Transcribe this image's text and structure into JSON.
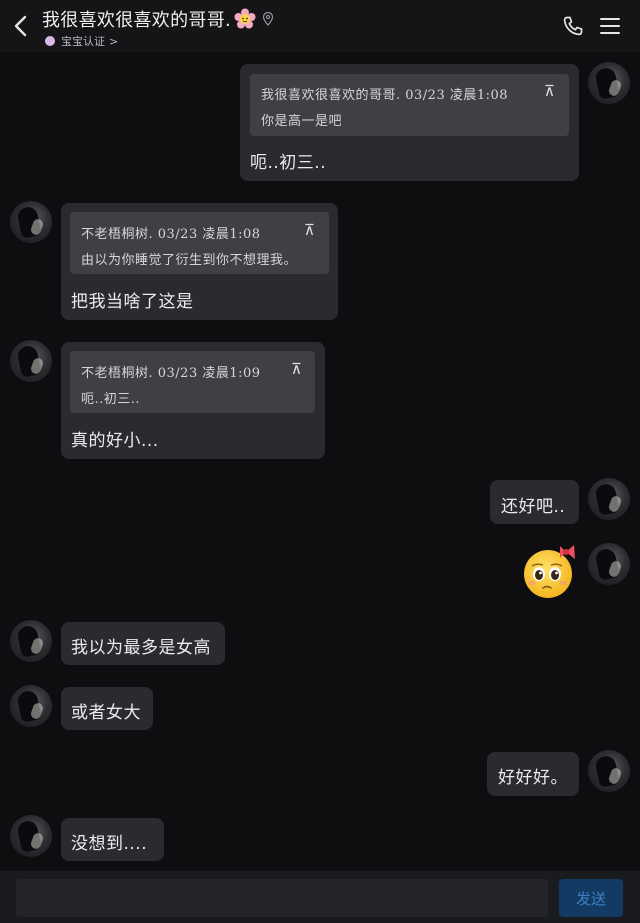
{
  "header": {
    "title": "我很喜欢很喜欢的哥哥.",
    "subtitle": "宝宝认证",
    "subtitle_chevron": ">"
  },
  "icons": {
    "back": "back-arrow-icon",
    "title_emoji": "flower-face-emoji",
    "pin": "location-pin-icon",
    "phone": "phone-icon",
    "menu": "hamburger-menu-icon",
    "sticker": "pleading-face-with-bow-sticker"
  },
  "messages": [
    {
      "side": "right",
      "quote": {
        "author_time": "我很喜欢很喜欢的哥哥. 03/23 凌晨1:08",
        "text": "你是高一是吧",
        "top_mark": "⊼"
      },
      "text": "呃..初三.."
    },
    {
      "side": "left",
      "quote": {
        "author_time": "不老梧桐树. 03/23 凌晨1:08",
        "text": "由以为你睡觉了衍生到你不想理我。",
        "top_mark": "⊼"
      },
      "text": "把我当啥了这是"
    },
    {
      "side": "left",
      "quote": {
        "author_time": "不老梧桐树. 03/23 凌晨1:09",
        "text": "呃..初三..",
        "top_mark": "⊼"
      },
      "text": "真的好小..."
    },
    {
      "side": "right",
      "text": "还好吧.."
    },
    {
      "side": "right",
      "sticker": true
    },
    {
      "side": "left",
      "text": "我以为最多是女高"
    },
    {
      "side": "left",
      "text": "或者女大"
    },
    {
      "side": "right",
      "text": "好好好。"
    },
    {
      "side": "left",
      "text": "没想到...."
    }
  ],
  "composer": {
    "placeholder": "",
    "send_label": "发送"
  },
  "colors": {
    "background": "#0e0e10",
    "bubble": "#2a2b30",
    "quote": "#3f4044",
    "send_button": "#123a63",
    "send_text": "#3d7fc4"
  }
}
